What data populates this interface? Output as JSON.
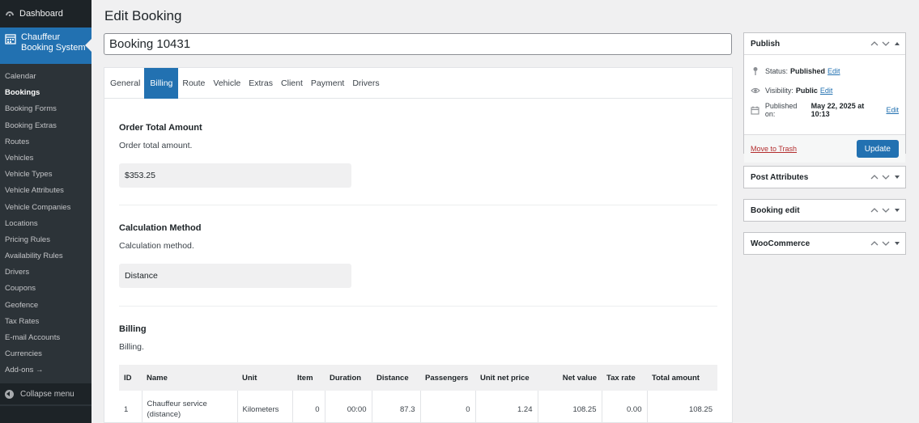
{
  "sidebar": {
    "dashboard_label": "Dashboard",
    "active_label_line1": "Chauffeur",
    "active_label_line2": "Booking System",
    "items": [
      {
        "label": "Calendar"
      },
      {
        "label": "Bookings"
      },
      {
        "label": "Booking Forms"
      },
      {
        "label": "Booking Extras"
      },
      {
        "label": "Routes"
      },
      {
        "label": "Vehicles"
      },
      {
        "label": "Vehicle Types"
      },
      {
        "label": "Vehicle Attributes"
      },
      {
        "label": "Vehicle Companies"
      },
      {
        "label": "Locations"
      },
      {
        "label": "Pricing Rules"
      },
      {
        "label": "Availability Rules"
      },
      {
        "label": "Drivers"
      },
      {
        "label": "Coupons"
      },
      {
        "label": "Geofence"
      },
      {
        "label": "Tax Rates"
      },
      {
        "label": "E-mail Accounts"
      },
      {
        "label": "Currencies"
      },
      {
        "label": "Add-ons →"
      }
    ],
    "collapse_label": "Collapse menu"
  },
  "page": {
    "title": "Edit Booking",
    "booking_title": "Booking 10431"
  },
  "tabs": [
    {
      "label": "General"
    },
    {
      "label": "Billing"
    },
    {
      "label": "Route"
    },
    {
      "label": "Vehicle"
    },
    {
      "label": "Extras"
    },
    {
      "label": "Client"
    },
    {
      "label": "Payment"
    },
    {
      "label": "Drivers"
    }
  ],
  "billing_tab": {
    "order_total": {
      "title": "Order Total Amount",
      "desc": "Order total amount.",
      "value": "$353.25"
    },
    "calc_method": {
      "title": "Calculation Method",
      "desc": "Calculation method.",
      "value": "Distance"
    },
    "billing": {
      "title": "Billing",
      "desc": "Billing."
    },
    "table": {
      "headers": [
        "ID",
        "Name",
        "Unit",
        "Item",
        "Duration",
        "Distance",
        "Passengers",
        "Unit net price",
        "Net value",
        "Tax rate",
        "Total amount"
      ],
      "rows": [
        {
          "id": "1",
          "name_line1": "Chauffeur service",
          "name_line2": "(distance)",
          "unit": "Kilometers",
          "item": "0",
          "duration": "00:00",
          "distance": "87.3",
          "passengers": "0",
          "unit_net_price": "1.24",
          "net_value": "108.25",
          "tax_rate": "0.00",
          "total": "108.25"
        }
      ]
    }
  },
  "publish": {
    "title": "Publish",
    "status_label": "Status:",
    "status_value": "Published",
    "visibility_label": "Visibility:",
    "visibility_value": "Public",
    "published_label": "Published on:",
    "published_value": "May 22, 2025 at 10:13",
    "edit_link": "Edit",
    "trash_label": "Move to Trash",
    "update_label": "Update"
  },
  "meta_boxes": [
    {
      "title": "Post Attributes"
    },
    {
      "title": "Booking edit"
    },
    {
      "title": "WooCommerce"
    }
  ],
  "colors": {
    "accent": "#2271b1",
    "sidebar": "#1d2327",
    "danger": "#b32d2e"
  }
}
